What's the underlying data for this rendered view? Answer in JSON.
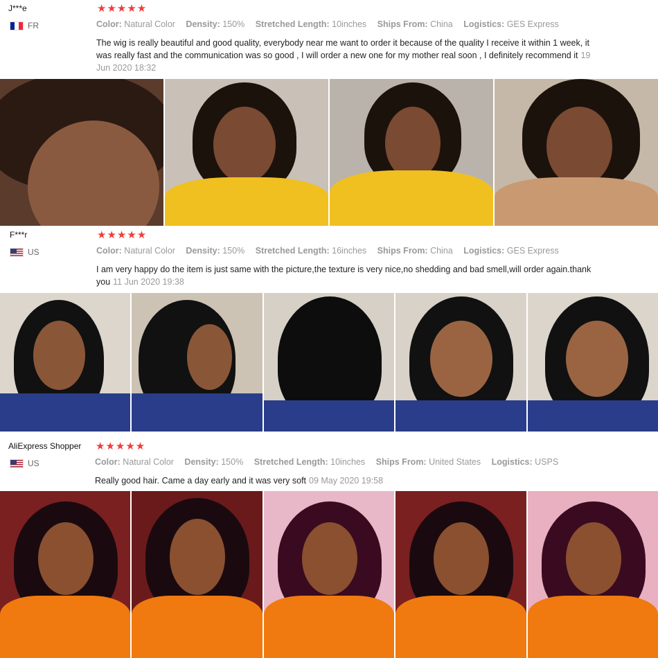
{
  "reviews": [
    {
      "reviewer": "J***e",
      "country": "FR",
      "flag": "flag-fr",
      "stars": "★★★★★",
      "attributes": [
        {
          "key": "Color:",
          "value": "Natural Color"
        },
        {
          "key": "Density:",
          "value": "150%"
        },
        {
          "key": "Stretched Length:",
          "value": "10inches"
        },
        {
          "key": "Ships From:",
          "value": "China"
        },
        {
          "key": "Logistics:",
          "value": "GES Express"
        }
      ],
      "comment": "The wig is really beautiful and good quality, everybody near me want to order it because of the quality I receive it within 1 week, it was really fast and the communication was so good , I will order a new one for my mother real soon , I definitely recommend it",
      "date": "19 Jun 2020 18:32",
      "photo_colors": [
        "#6b4a3a",
        "#c9a02a",
        "#d9b33a",
        "#b08060"
      ]
    },
    {
      "reviewer": "F***r",
      "country": "US",
      "flag": "flag-us",
      "stars": "★★★★★",
      "attributes": [
        {
          "key": "Color:",
          "value": "Natural Color"
        },
        {
          "key": "Density:",
          "value": "150%"
        },
        {
          "key": "Stretched Length:",
          "value": "16inches"
        },
        {
          "key": "Ships From:",
          "value": "China"
        },
        {
          "key": "Logistics:",
          "value": "GES Express"
        }
      ],
      "comment": "I am very happy do the item is just same with the picture,the texture is very nice,no shedding and bad smell,will order again.thank you",
      "date": "11 Jun 2020 19:38",
      "photo_colors": [
        "#2a3d8a",
        "#2a3d8a",
        "#2a3d8a",
        "#2a3d8a",
        "#2a3d8a"
      ]
    },
    {
      "reviewer": "AliExpress Shopper",
      "country": "US",
      "flag": "flag-us",
      "stars": "★★★★★",
      "attributes": [
        {
          "key": "Color:",
          "value": "Natural Color"
        },
        {
          "key": "Density:",
          "value": "150%"
        },
        {
          "key": "Stretched Length:",
          "value": "10inches"
        },
        {
          "key": "Ships From:",
          "value": "United States"
        },
        {
          "key": "Logistics:",
          "value": "USPS"
        }
      ],
      "comment": "Really good hair. Came a day early and it was very soft",
      "date": "09 May 2020 19:58",
      "photo_colors": [
        "#f07a10",
        "#f07a10",
        "#f07a10",
        "#f07a10",
        "#f07a10"
      ]
    }
  ],
  "colors": {
    "star": "#f23b3b",
    "muted": "#999999"
  }
}
